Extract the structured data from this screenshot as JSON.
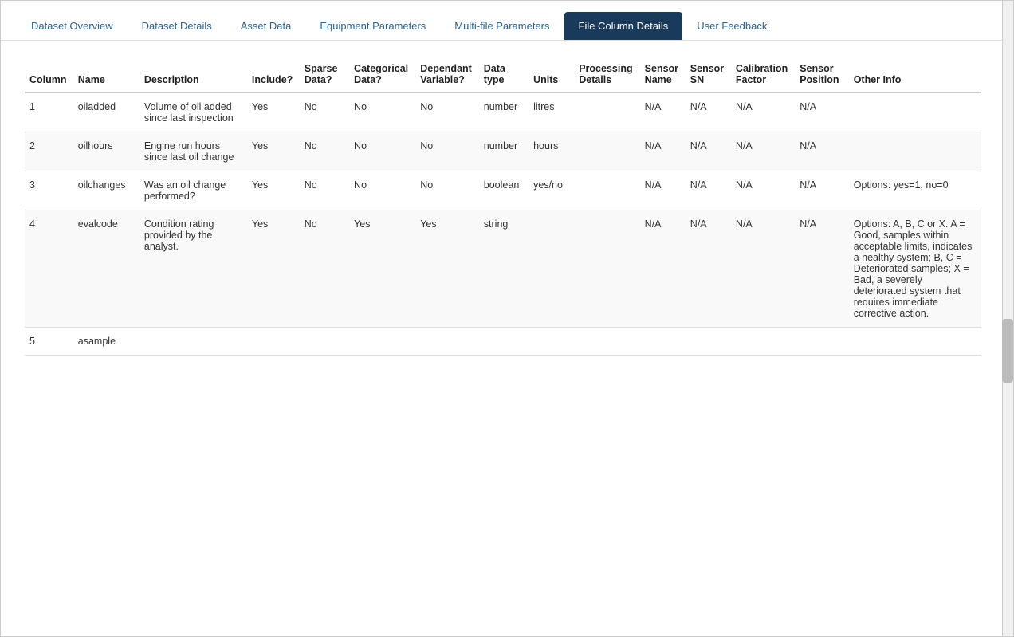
{
  "tabs": [
    {
      "id": "dataset-overview",
      "label": "Dataset Overview",
      "active": false
    },
    {
      "id": "dataset-details",
      "label": "Dataset Details",
      "active": false
    },
    {
      "id": "asset-data",
      "label": "Asset Data",
      "active": false
    },
    {
      "id": "equipment-parameters",
      "label": "Equipment Parameters",
      "active": false
    },
    {
      "id": "multi-file-parameters",
      "label": "Multi-file Parameters",
      "active": false
    },
    {
      "id": "file-column-details",
      "label": "File Column Details",
      "active": true
    },
    {
      "id": "user-feedback",
      "label": "User Feedback",
      "active": false
    }
  ],
  "table": {
    "headers": {
      "column": "Column",
      "name": "Name",
      "description": "Description",
      "include": "Include?",
      "sparse": "Sparse Data?",
      "categorical": "Categorical Data?",
      "dependant": "Dependant Variable?",
      "datatype": "Data type",
      "units": "Units",
      "processing": "Processing Details",
      "sensorname": "Sensor Name",
      "sensorsn": "Sensor SN",
      "calibration": "Calibration Factor",
      "sensorpos": "Sensor Position",
      "otherinfo": "Other Info"
    },
    "rows": [
      {
        "column": "1",
        "name": "oiladded",
        "description": "Volume of oil added since last inspection",
        "include": "Yes",
        "sparse": "No",
        "categorical": "No",
        "dependant": "No",
        "datatype": "number",
        "units": "litres",
        "processing": "",
        "sensorname": "N/A",
        "sensorsn": "N/A",
        "calibration": "N/A",
        "sensorpos": "N/A",
        "otherinfo": ""
      },
      {
        "column": "2",
        "name": "oilhours",
        "description": "Engine run hours since last oil change",
        "include": "Yes",
        "sparse": "No",
        "categorical": "No",
        "dependant": "No",
        "datatype": "number",
        "units": "hours",
        "processing": "",
        "sensorname": "N/A",
        "sensorsn": "N/A",
        "calibration": "N/A",
        "sensorpos": "N/A",
        "otherinfo": ""
      },
      {
        "column": "3",
        "name": "oilchanges",
        "description": "Was an oil change performed?",
        "include": "Yes",
        "sparse": "No",
        "categorical": "No",
        "dependant": "No",
        "datatype": "boolean",
        "units": "yes/no",
        "processing": "",
        "sensorname": "N/A",
        "sensorsn": "N/A",
        "calibration": "N/A",
        "sensorpos": "N/A",
        "otherinfo": "Options: yes=1, no=0"
      },
      {
        "column": "4",
        "name": "evalcode",
        "description": "Condition rating provided by the analyst.",
        "include": "Yes",
        "sparse": "No",
        "categorical": "Yes",
        "dependant": "Yes",
        "datatype": "string",
        "units": "",
        "processing": "",
        "sensorname": "N/A",
        "sensorsn": "N/A",
        "calibration": "N/A",
        "sensorpos": "N/A",
        "otherinfo": "Options: A, B, C or X. A = Good, samples within acceptable limits, indicates a healthy system; B, C = Deteriorated samples; X = Bad, a severely deteriorated system that requires immediate corrective action."
      },
      {
        "column": "5",
        "name": "asample",
        "description": "",
        "include": "",
        "sparse": "",
        "categorical": "",
        "dependant": "",
        "datatype": "",
        "units": "",
        "processing": "",
        "sensorname": "",
        "sensorsn": "",
        "calibration": "",
        "sensorpos": "",
        "otherinfo": ""
      }
    ]
  }
}
